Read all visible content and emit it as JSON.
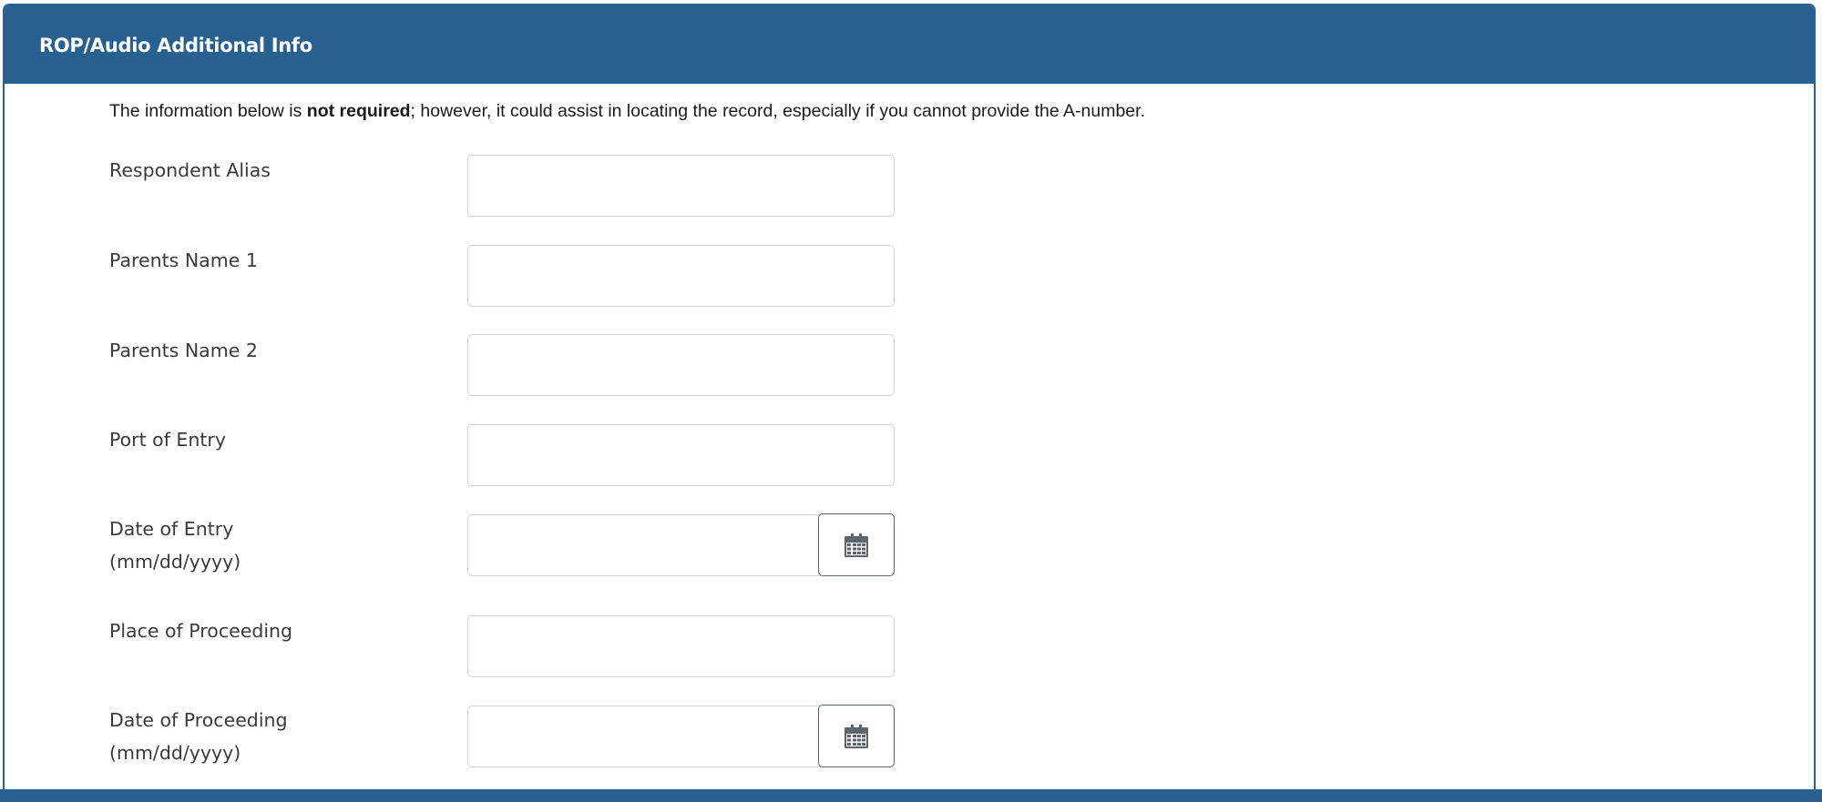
{
  "panel": {
    "title": "ROP/Audio Additional Info"
  },
  "intro": {
    "prefix": "The information below is ",
    "bold": "not required",
    "suffix": "; however, it could assist in locating the record, especially if you cannot provide the A-number."
  },
  "fields": {
    "respondent_alias": {
      "label": "Respondent Alias",
      "value": ""
    },
    "parents_name_1": {
      "label": "Parents Name 1",
      "value": ""
    },
    "parents_name_2": {
      "label": "Parents Name 2",
      "value": ""
    },
    "port_of_entry": {
      "label": "Port of Entry",
      "value": ""
    },
    "date_of_entry": {
      "label": "Date of Entry",
      "hint": "(mm/dd/yyyy)",
      "value": "",
      "icon": "calendar-icon"
    },
    "place_of_proceeding": {
      "label": "Place of Proceeding",
      "value": ""
    },
    "date_of_proceeding": {
      "label": "Date of Proceeding",
      "hint": "(mm/dd/yyyy)",
      "value": "",
      "icon": "calendar-icon"
    }
  },
  "colors": {
    "header_bg": "#28608f",
    "header_text": "#ffffff",
    "input_border": "#d0d3d8",
    "calendar_button_border": "#5d6670",
    "calendar_icon": "#5d6670"
  }
}
